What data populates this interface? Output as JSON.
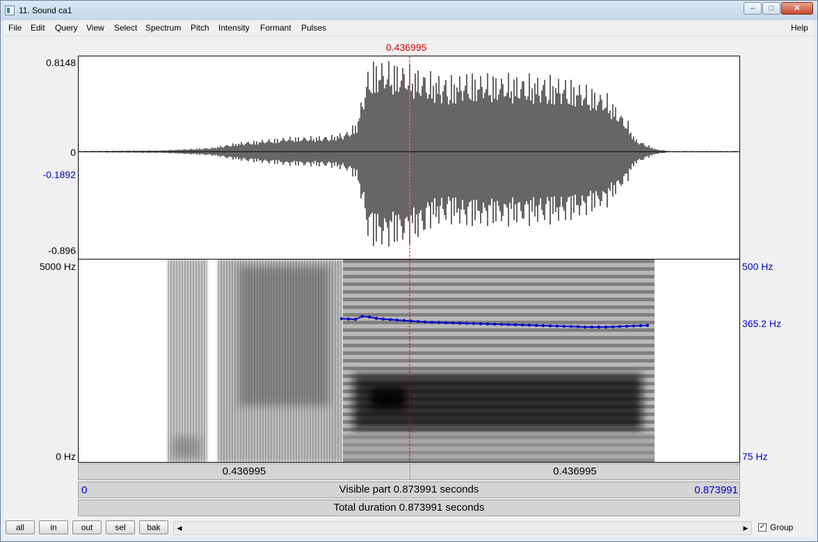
{
  "window": {
    "title": "11. Sound ca1",
    "minimize": "–",
    "maximize": "□",
    "close": "✕"
  },
  "menu": {
    "items": [
      "File",
      "Edit",
      "Query",
      "View",
      "Select",
      "Spectrum",
      "Pitch",
      "Intensity",
      "Formant",
      "Pulses"
    ],
    "help": "Help"
  },
  "cursor": {
    "time_label": "0.436995",
    "color": "#d00000"
  },
  "waveform": {
    "y_max": "0.8148",
    "y_zero": "0",
    "y_cursor": "-0.1892",
    "y_min": "-0.896"
  },
  "spectrogram": {
    "y_top": "5000 Hz",
    "y_bottom": "0 Hz"
  },
  "pitch": {
    "y_top": "500 Hz",
    "y_cursor": "365.2 Hz",
    "y_bottom": "75 Hz",
    "color": "#0000c8"
  },
  "time_bar": {
    "left": "0.436995",
    "right": "0.436995"
  },
  "visible_bar": {
    "start": "0",
    "label": "Visible part 0.873991 seconds",
    "end": "0.873991"
  },
  "total_bar": {
    "label": "Total duration 0.873991 seconds"
  },
  "bottom": {
    "buttons": [
      "all",
      "in",
      "out",
      "sel",
      "bak"
    ],
    "group_checked": "✓",
    "group_label": "Group",
    "scroll_left": "◀",
    "scroll_right": "▶"
  }
}
